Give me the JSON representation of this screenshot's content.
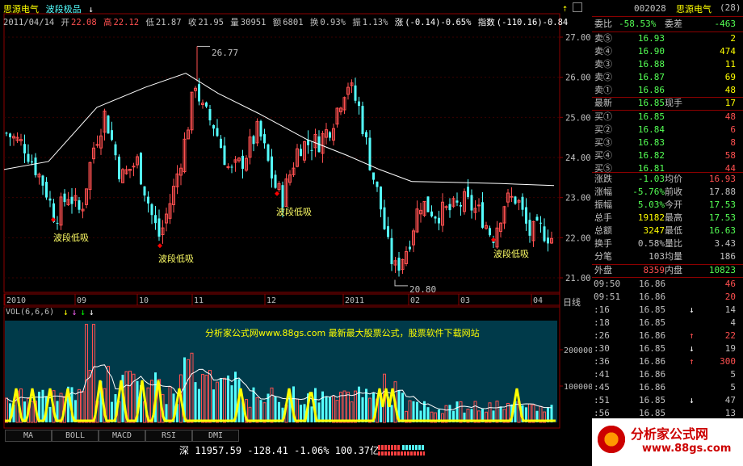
{
  "header": {
    "stock_name": "思源电气",
    "formula_name": "波段极品",
    "arrow": "↓",
    "date": "2011/04/14",
    "open_label": "开",
    "open": "22.08",
    "high_label": "高",
    "high": "22.12",
    "low_label": "低",
    "low": "21.87",
    "close_label": "收",
    "close": "21.95",
    "vol_label": "量",
    "vol": "30951",
    "amount_label": "额",
    "amount": "6801",
    "turnover_label": "换",
    "turnover": "0.93%",
    "amp_label": "振",
    "amp": "1.13%",
    "change_label": "涨",
    "change": "(-0.14)-0.65%",
    "index_label": "指数",
    "index": "(-110.16)-0.84"
  },
  "price_axis": [
    "27.00",
    "26.00",
    "25.00",
    "24.00",
    "23.00",
    "22.00",
    "21.00"
  ],
  "price_marks": {
    "high": "26.77",
    "low": "20.80",
    "signal_label": "波段低吸"
  },
  "time_axis": [
    "2010",
    "09",
    "10",
    "11",
    "12",
    "2011",
    "02",
    "03",
    "04"
  ],
  "right_corner": "日线",
  "vol_panel": {
    "title": "VOL(6,6,6)",
    "axis": [
      "200000",
      "100000"
    ],
    "watermark": "分析家公式网www.88gs.com 最新最大股票公式，股票软件下载网站"
  },
  "tabs": [
    "MA",
    "BOLL",
    "MACD",
    "RSI",
    "DMI"
  ],
  "status_bar": {
    "market": "深",
    "index": "11957.59",
    "change": "-128.41",
    "pct": "-1.06%",
    "amount": "100.37亿"
  },
  "quote": {
    "code": "002028",
    "name": "思源电气",
    "badge": "28",
    "weibi_label": "委比",
    "weibi": "-58.53%",
    "weicha_label": "委差",
    "weicha": "-463",
    "asks": [
      {
        "label": "卖⑤",
        "price": "16.93",
        "vol": "2"
      },
      {
        "label": "卖④",
        "price": "16.90",
        "vol": "474"
      },
      {
        "label": "卖③",
        "price": "16.88",
        "vol": "11"
      },
      {
        "label": "卖②",
        "price": "16.87",
        "vol": "69"
      },
      {
        "label": "卖①",
        "price": "16.86",
        "vol": "48"
      }
    ],
    "last_label": "最新",
    "last": "16.85",
    "hand_label": "现手",
    "hand": "17",
    "bids": [
      {
        "label": "买①",
        "price": "16.85",
        "vol": "48"
      },
      {
        "label": "买②",
        "price": "16.84",
        "vol": "6"
      },
      {
        "label": "买③",
        "price": "16.83",
        "vol": "8"
      },
      {
        "label": "买④",
        "price": "16.82",
        "vol": "58"
      },
      {
        "label": "买⑤",
        "price": "16.81",
        "vol": "44"
      }
    ],
    "stats": [
      {
        "l1": "涨跌",
        "v1": "-1.03",
        "l2": "均价",
        "v2": "16.93"
      },
      {
        "l1": "涨幅",
        "v1": "-5.76%",
        "l2": "前收",
        "v2": "17.88"
      },
      {
        "l1": "振幅",
        "v1": "5.03%",
        "l2": "今开",
        "v2": "17.53"
      },
      {
        "l1": "总手",
        "v1": "19182",
        "l2": "最高",
        "v2": "17.53"
      },
      {
        "l1": "总额",
        "v1": "3247",
        "l2": "最低",
        "v2": "16.63"
      },
      {
        "l1": "换手",
        "v1": "0.58%",
        "l2": "量比",
        "v2": "3.43"
      },
      {
        "l1": "分笔",
        "v1": "103",
        "l2": "均量",
        "v2": "186"
      }
    ],
    "outer_label": "外盘",
    "outer": "8359",
    "inner_label": "内盘",
    "inner": "10823",
    "ticks": [
      {
        "t": "09:50",
        "p": "16.86",
        "a": "",
        "v": "46"
      },
      {
        "t": "09:51",
        "p": "16.86",
        "a": "",
        "v": "20"
      },
      {
        "t": ":16",
        "p": "16.85",
        "a": "↓",
        "v": "14"
      },
      {
        "t": ":18",
        "p": "16.85",
        "a": "",
        "v": "4"
      },
      {
        "t": ":26",
        "p": "16.86",
        "a": "↑",
        "v": "22"
      },
      {
        "t": ":30",
        "p": "16.85",
        "a": "↓",
        "v": "19"
      },
      {
        "t": ":36",
        "p": "16.86",
        "a": "↑",
        "v": "300"
      },
      {
        "t": ":41",
        "p": "16.86",
        "a": "",
        "v": "5"
      },
      {
        "t": ":45",
        "p": "16.86",
        "a": "",
        "v": "5"
      },
      {
        "t": ":51",
        "p": "16.85",
        "a": "↓",
        "v": "47"
      },
      {
        "t": ":56",
        "p": "16.85",
        "a": "",
        "v": "13"
      }
    ]
  },
  "logo": {
    "text": "分析家公式网",
    "url": "www.88gs.com"
  },
  "colors": {
    "up": "#ff5050",
    "down": "#54ffff",
    "ma": "#ffffff",
    "yellow": "#ffff00",
    "grid": "#8c0000",
    "panel": "#003a4a"
  }
}
